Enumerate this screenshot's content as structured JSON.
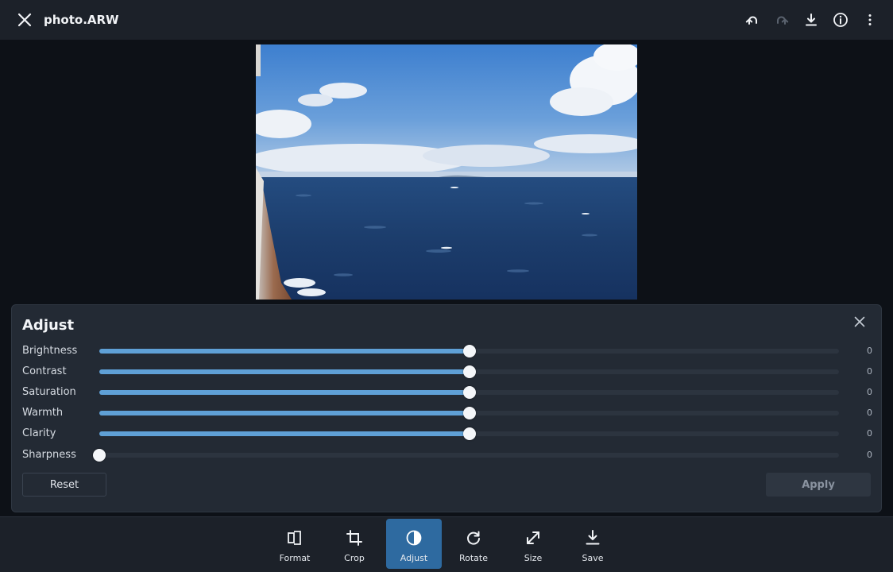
{
  "header": {
    "title": "photo.ARW",
    "close_icon": "close-icon",
    "actions": [
      "undo-icon",
      "redo-icon",
      "download-icon",
      "info-icon",
      "more-vert-icon"
    ]
  },
  "photo": {
    "subject": "ocean-view-from-ship"
  },
  "adjust_panel": {
    "title": "Adjust",
    "sliders": [
      {
        "label": "Brightness",
        "value": "0",
        "level": 0.5
      },
      {
        "label": "Contrast",
        "value": "0",
        "level": 0.5
      },
      {
        "label": "Saturation",
        "value": "0",
        "level": 0.5
      },
      {
        "label": "Warmth",
        "value": "0",
        "level": 0.5
      },
      {
        "label": "Clarity",
        "value": "0",
        "level": 0.5
      },
      {
        "label": "Sharpness",
        "value": "0",
        "level": 0.0
      }
    ],
    "reset_label": "Reset",
    "apply_label": "Apply"
  },
  "toolbar": {
    "tools": [
      {
        "label": "Format",
        "icon": "format-icon",
        "active": false
      },
      {
        "label": "Crop",
        "icon": "crop-icon",
        "active": false
      },
      {
        "label": "Adjust",
        "icon": "contrast-icon",
        "active": true
      },
      {
        "label": "Rotate",
        "icon": "rotate-icon",
        "active": false
      },
      {
        "label": "Size",
        "icon": "resize-icon",
        "active": false
      },
      {
        "label": "Save",
        "icon": "save-icon",
        "active": false
      }
    ]
  },
  "colors": {
    "accent": "#5fa0d6",
    "active_tool": "#2e6aa0",
    "panel_bg": "#232a34",
    "bar_bg": "#1c2129"
  }
}
